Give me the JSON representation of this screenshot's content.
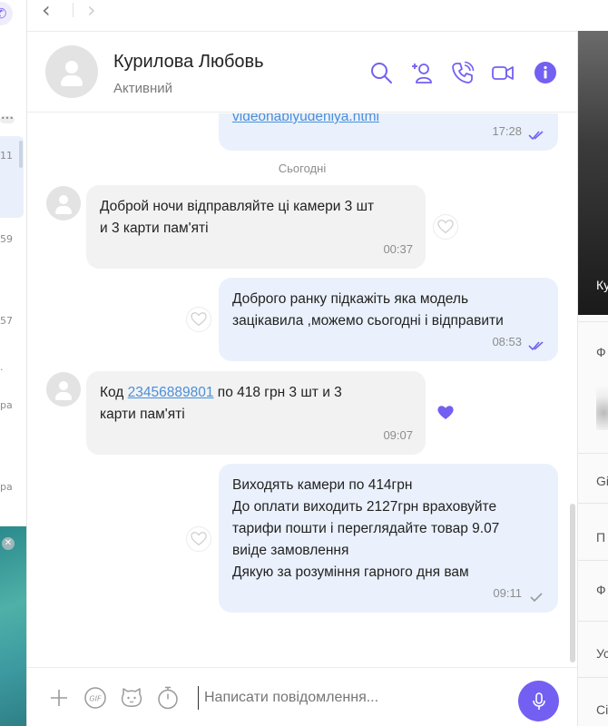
{
  "colors": {
    "accent": "#7360f2",
    "incoming_bubble": "#f2f2f2",
    "outgoing_bubble": "#eaf1fc",
    "link": "#4a8fd9"
  },
  "left_strip": {
    "times": [
      "11",
      "59",
      "57",
      ".",
      "ра",
      "ра"
    ]
  },
  "nav": {
    "back_icon": "chevron-left-icon",
    "forward_icon": "chevron-right-icon"
  },
  "header": {
    "name": "Курилова Любовь",
    "status": "Активний",
    "icons": [
      "search-icon",
      "add-contact-icon",
      "call-icon",
      "video-call-icon",
      "info-icon"
    ]
  },
  "chat": {
    "date_separator": "Сьогодні",
    "messages": [
      {
        "direction": "out",
        "text_link": "videonablyudeniya.html",
        "time": "17:28",
        "status": "read"
      },
      {
        "direction": "in",
        "lines": [
          "Доброй ночи відправляйте ці камери 3 шт",
          "и 3 карти пам'яті"
        ],
        "time": "00:37",
        "liked": false
      },
      {
        "direction": "out",
        "lines": [
          "Доброго ранку підкажіть яка модель",
          "зацікавила ,можемо сьогодні і відправити"
        ],
        "time": "08:53",
        "status": "read",
        "liked": false
      },
      {
        "direction": "in",
        "prefix": "Код ",
        "link": "23456889801",
        "suffix": " по 418 грн 3 шт и 3",
        "line2": "карти пам'яті",
        "time": "09:07",
        "liked": true
      },
      {
        "direction": "out",
        "lines": [
          "Виходять камери по 414грн",
          "До оплати виходить 2127грн враховуйте",
          "тарифи пошти і переглядайте товар 9.07",
          "виіде замовлення",
          "Дякую за розуміння гарного дня вам"
        ],
        "time": "09:11",
        "status": "delivered",
        "liked": false
      }
    ]
  },
  "composer": {
    "placeholder": "Написати повідомлення...",
    "icons": [
      "plus-icon",
      "gif-icon",
      "sticker-icon",
      "timer-icon",
      "microphone-icon"
    ]
  },
  "right_panel": {
    "video_caption": "Ку",
    "items": [
      "Ф",
      "Gi",
      "П",
      "Ф",
      "Ус",
      "Сі"
    ]
  }
}
